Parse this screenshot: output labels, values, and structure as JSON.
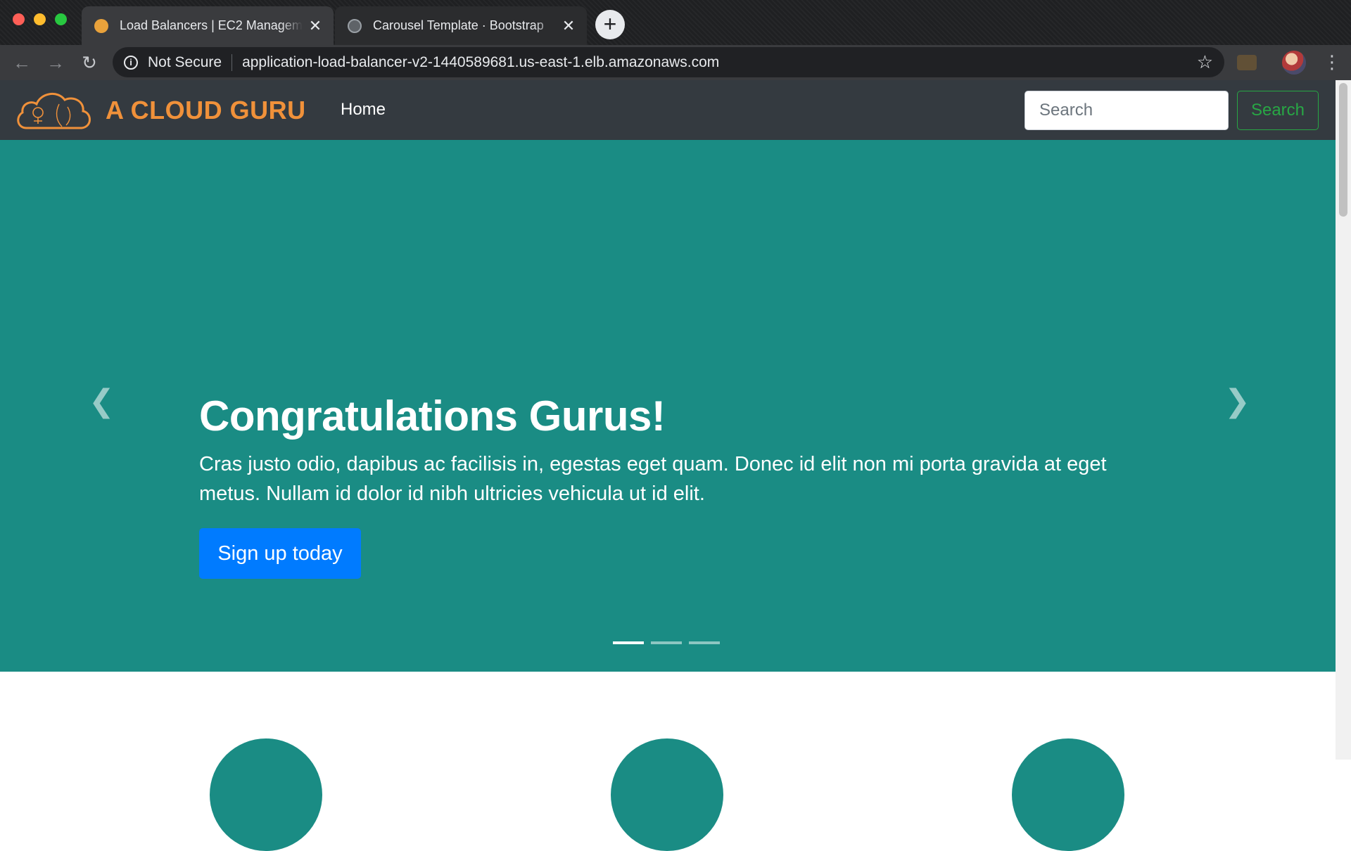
{
  "browser": {
    "tabs": [
      {
        "title": "Load Balancers | EC2 Management Console",
        "active": true
      },
      {
        "title": "Carousel Template · Bootstrap",
        "active": false
      }
    ],
    "close_glyph": "✕",
    "new_tab_glyph": "+",
    "security_label": "Not Secure",
    "url": "application-load-balancer-v2-1440589681.us-east-1.elb.amazonaws.com",
    "icons": [
      "back-icon",
      "forward-icon",
      "reload-icon",
      "info-icon",
      "star-icon",
      "extension-icon",
      "profile-avatar",
      "more-menu-icon"
    ]
  },
  "navbar": {
    "brand": "A CLOUD GURU",
    "brand_color": "#f0913a",
    "home_link": "Home",
    "search_placeholder": "Search",
    "search_button": "Search"
  },
  "carousel": {
    "background": "#1a8c84",
    "title": "Congratulations Gurus!",
    "text": "Cras justo odio, dapibus ac facilisis in, egestas eget quam. Donec id elit non mi porta gravida at eget metus. Nullam id dolor id nibh ultricies vehicula ut id elit.",
    "cta": "Sign up today",
    "slide_count": 3,
    "active_slide": 1
  },
  "colors": {
    "navbar_bg": "#343a40",
    "primary": "#007bff",
    "success": "#28a745"
  }
}
